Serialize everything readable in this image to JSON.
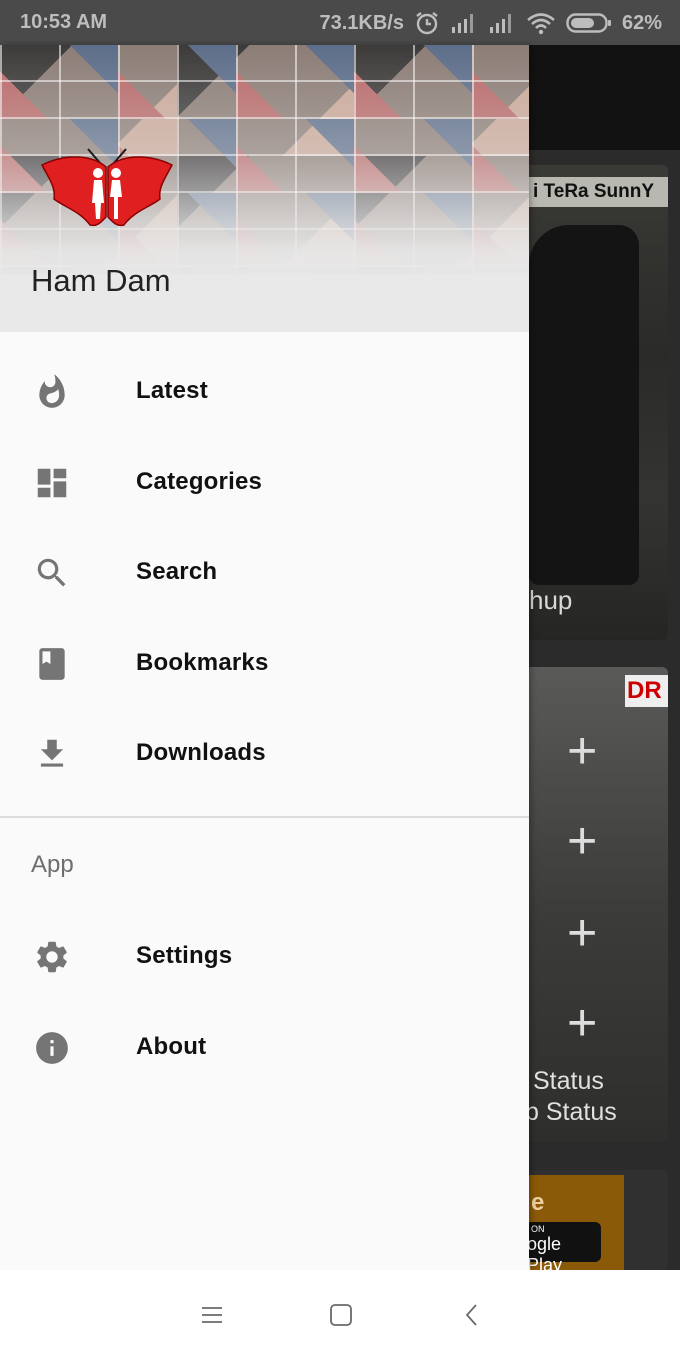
{
  "status_bar": {
    "time": "10:53 AM",
    "speed": "73.1KB/s",
    "battery": "62%",
    "icons": [
      "alarm-icon",
      "signal-icon",
      "signal-icon",
      "wifi-icon",
      "battery-icon"
    ]
  },
  "background": {
    "card1_title": "i TeRa SunnY",
    "card1_caption": "hup",
    "card2_badge": "DR",
    "card2_caption_line1": "Status",
    "card2_caption_line2": "p Status",
    "card3_promo": "e",
    "card3_store": "ogle Play",
    "card3_store_small": "ON"
  },
  "drawer": {
    "header_title": "Ham Dam",
    "logo_icon": "butterfly-logo",
    "colors": {
      "logo_red": "#e02020",
      "icon_gray": "#757575",
      "header_bg": "#e9e9e9"
    },
    "items": [
      {
        "label": "Latest",
        "icon": "fire-icon"
      },
      {
        "label": "Categories",
        "icon": "dashboard-icon"
      },
      {
        "label": "Search",
        "icon": "search-icon"
      },
      {
        "label": "Bookmarks",
        "icon": "bookmark-icon"
      },
      {
        "label": "Downloads",
        "icon": "download-icon"
      }
    ],
    "section_title": "App",
    "app_items": [
      {
        "label": "Settings",
        "icon": "gear-icon"
      },
      {
        "label": "About",
        "icon": "info-icon"
      }
    ]
  },
  "nav_bar": {
    "buttons": [
      "menu-icon",
      "home-icon",
      "back-icon"
    ]
  }
}
